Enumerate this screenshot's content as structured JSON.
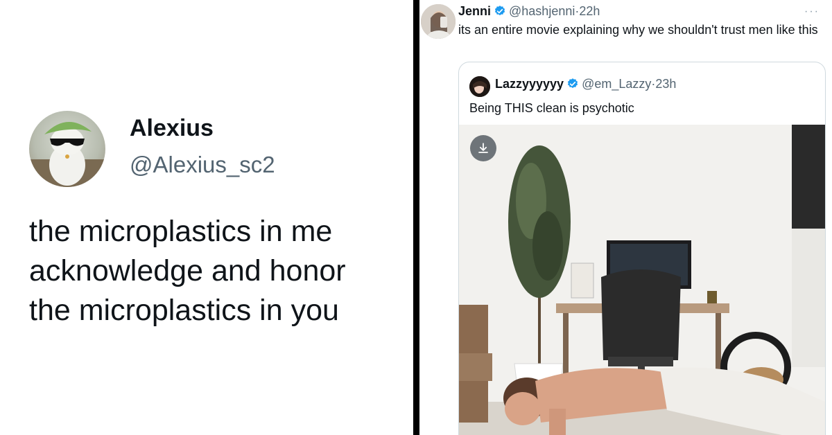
{
  "left_tweet": {
    "display_name": "Alexius",
    "handle": "@Alexius_sc2",
    "text_lines": [
      "the microplastics in me",
      "acknowledge and honor",
      "the microplastics in you"
    ],
    "avatar_icon": "cat-with-sunglasses-avatar"
  },
  "right_tweet": {
    "display_name": "Jenni",
    "handle": "@hashjenni",
    "time": "22h",
    "separator": "·",
    "more_icon": "more-options-icon",
    "more_label": "···",
    "text": "its an entire movie explaining why we shouldn't trust men like this",
    "verified_color": "#1d9bf0",
    "quoted_tweet": {
      "display_name": "Lazzyyyyyy",
      "handle": "@em_Lazzy",
      "time": "23h",
      "separator": "·",
      "text": "Being THIS clean is psychotic",
      "media_icon": "download-icon"
    }
  },
  "colors": {
    "text_primary": "#0f1419",
    "text_secondary": "#536471",
    "divider": "#000000",
    "card_border": "#cfd9de"
  }
}
